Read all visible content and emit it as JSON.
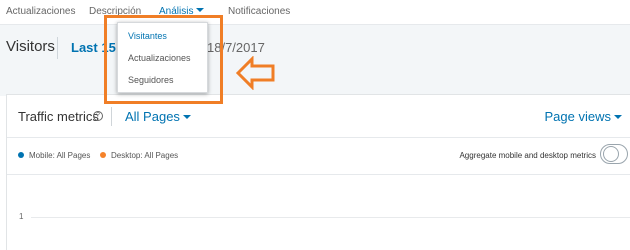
{
  "nav": {
    "tabs": [
      {
        "label": "Actualizaciones"
      },
      {
        "label": "Descripción"
      },
      {
        "label": "Análisis"
      },
      {
        "label": "Notificaciones"
      }
    ]
  },
  "visitors": {
    "title": "Visitors",
    "range": "Last 15 days",
    "date_end": "18/7/2017"
  },
  "dropdown": {
    "items": [
      {
        "label": "Visitantes"
      },
      {
        "label": "Actualizaciones"
      },
      {
        "label": "Seguidores"
      }
    ]
  },
  "card": {
    "title": "Traffic metrics",
    "help_glyph": "?",
    "pages_filter": "All Pages",
    "metric_selector": "Page views",
    "legend": [
      {
        "label": "Mobile: All Pages",
        "color": "#0073b1"
      },
      {
        "label": "Desktop: All Pages",
        "color": "#f5822a"
      }
    ],
    "aggregate_label": "Aggregate mobile and desktop metrics",
    "aggregate_on": false,
    "y_tick": "1"
  },
  "colors": {
    "accent": "#0073b1",
    "annotation": "#f07e26"
  }
}
